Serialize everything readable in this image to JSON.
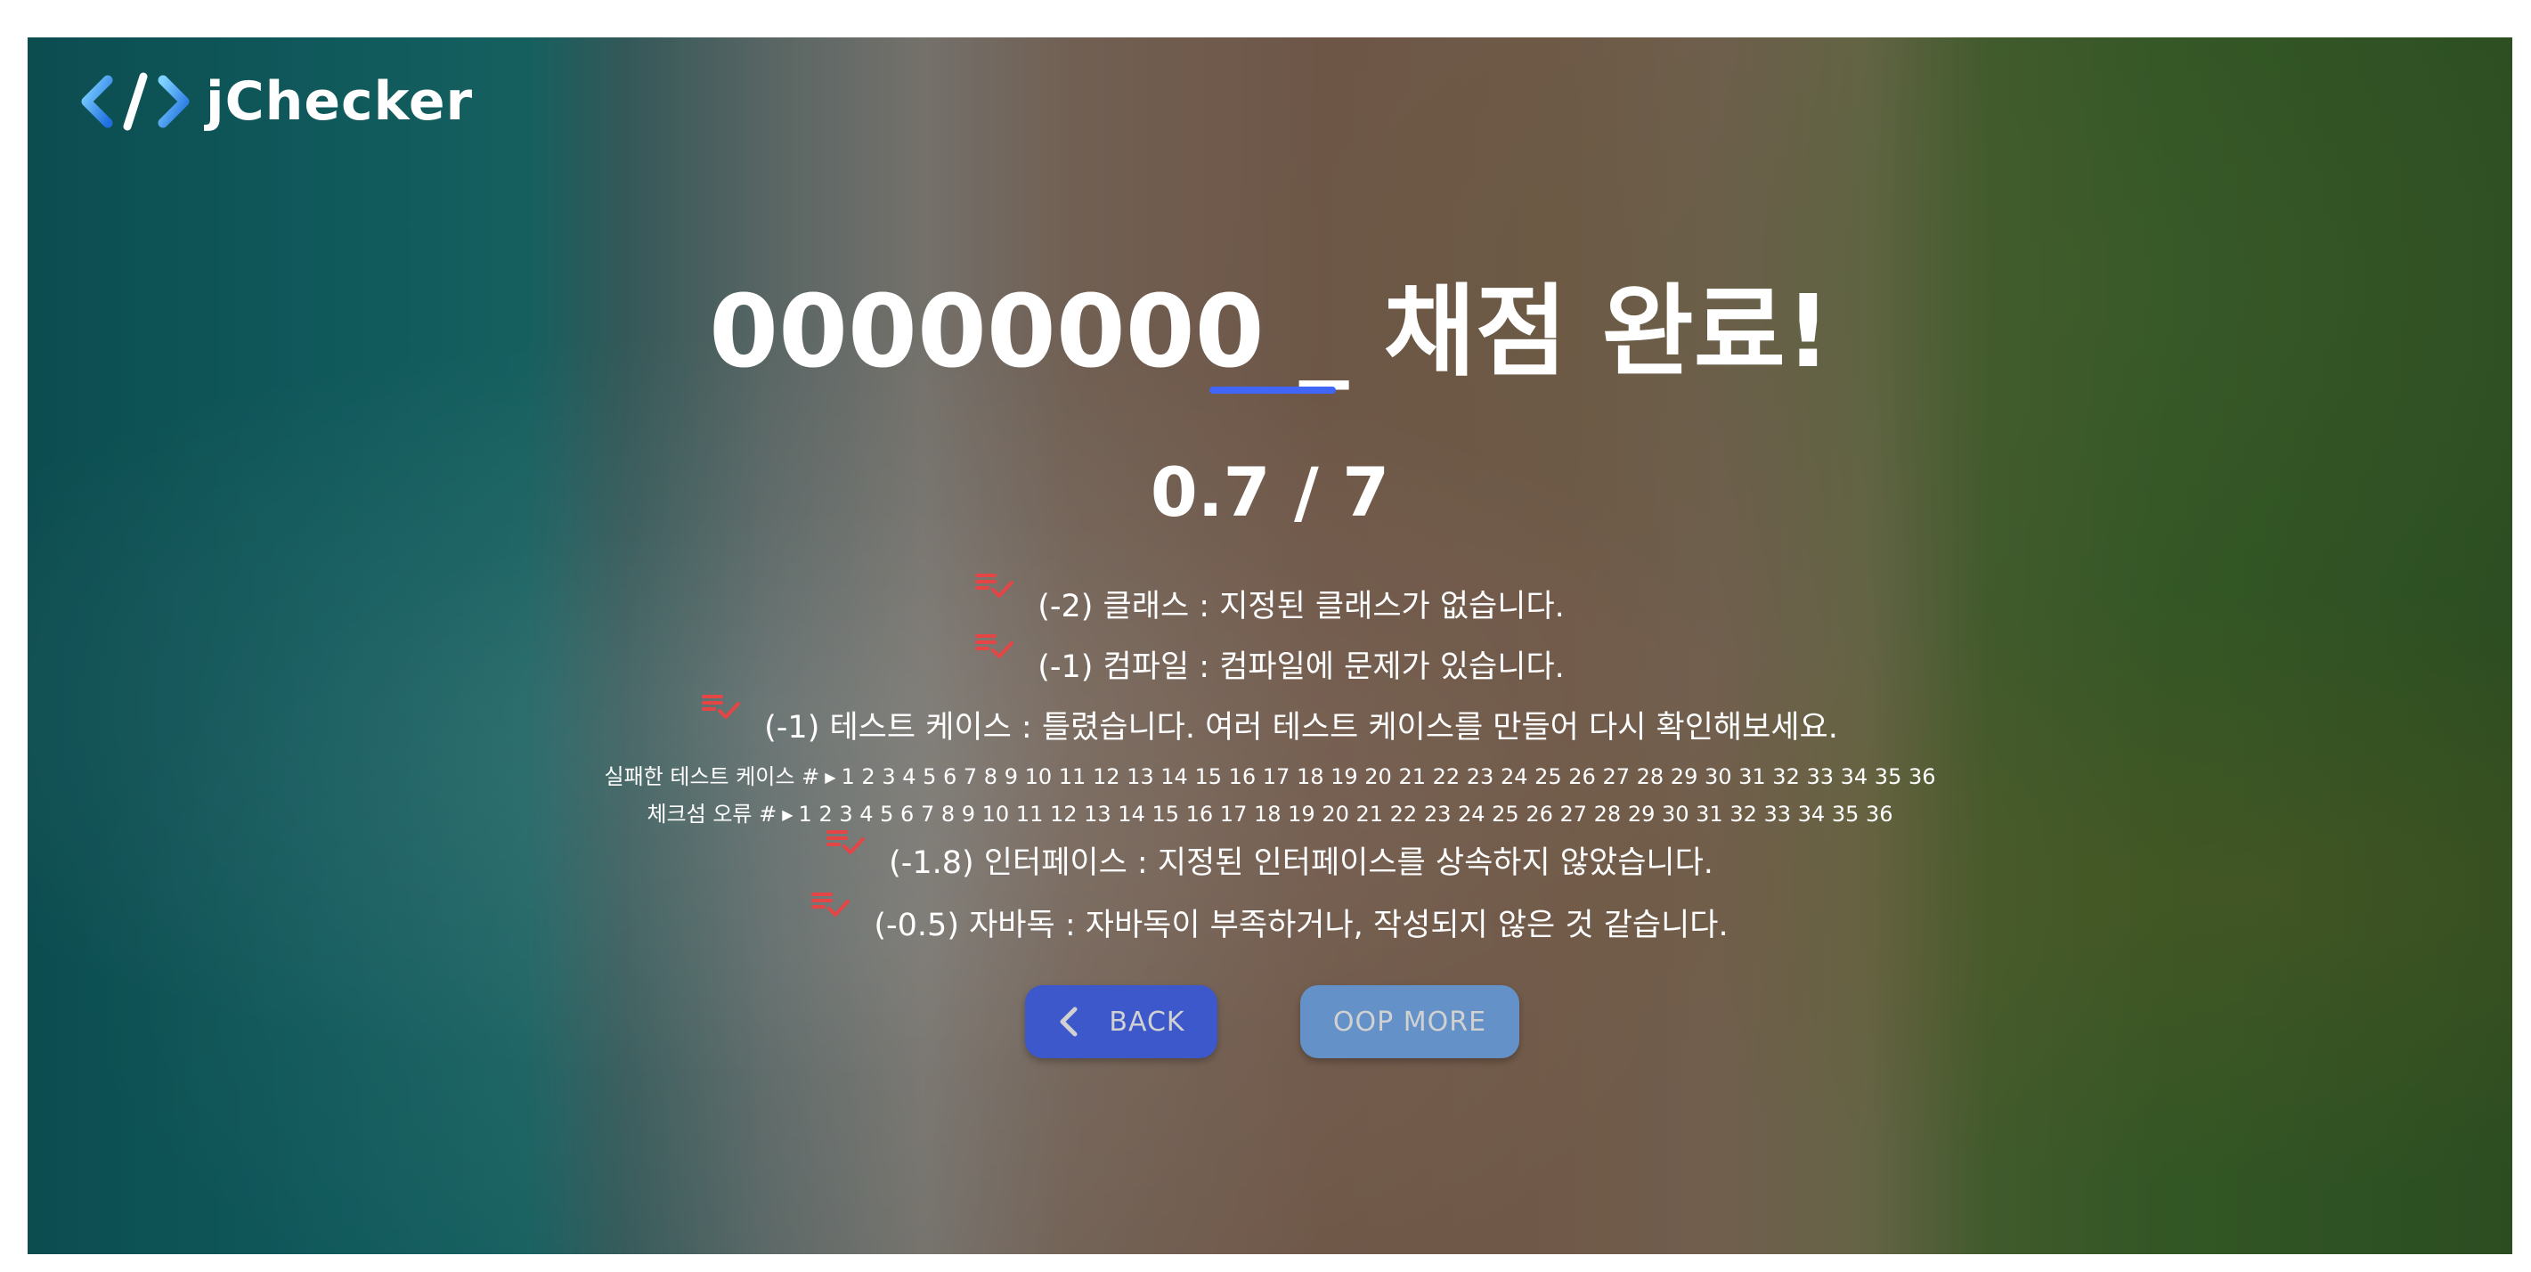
{
  "logo": {
    "text": "jChecker"
  },
  "result": {
    "title": "00000000 _ 채점 완료!",
    "score": "0.7 / 7"
  },
  "deductions": [
    {
      "text": "(-2) 클래스 : 지정된 클래스가 없습니다."
    },
    {
      "text": "(-1) 컴파일 : 컴파일에 문제가 있습니다."
    },
    {
      "text": "(-1) 테스트 케이스 : 틀렸습니다. 여러 테스트 케이스를 만들어 다시 확인해보세요."
    },
    {
      "text": "(-1.8) 인터페이스 : 지정된 인터페이스를 상속하지 않았습니다."
    },
    {
      "text": "(-0.5) 자바독 : 자바독이 부족하거나, 작성되지 않은 것 같습니다."
    }
  ],
  "failed_tests": {
    "label": "실패한 테스트 케이스 #",
    "numbers": "1 2 3 4 5 6 7 8 9 10 11 12 13 14 15 16 17 18 19 20 21 22 23 24 25 26 27 28 29 30 31 32 33 34 35 36"
  },
  "checksum_errors": {
    "label": "체크섬 오류 #",
    "numbers": "1 2 3 4 5 6 7 8 9 10 11 12 13 14 15 16 17 18 19 20 21 22 23 24 25 26 27 28 29 30 31 32 33 34 35 36"
  },
  "buttons": {
    "back_label": "BACK",
    "more_label": "OOP MORE"
  },
  "colors": {
    "accent": "#4166f5",
    "back_button": "#4a6cf7",
    "more_button": "#79b1f4",
    "check_icon": "#e64545"
  },
  "icons": {
    "logo": "code-brackets-icon",
    "deduction": "checklist-icon",
    "back": "chevron-left-icon",
    "expand": "play-triangle-icon"
  }
}
